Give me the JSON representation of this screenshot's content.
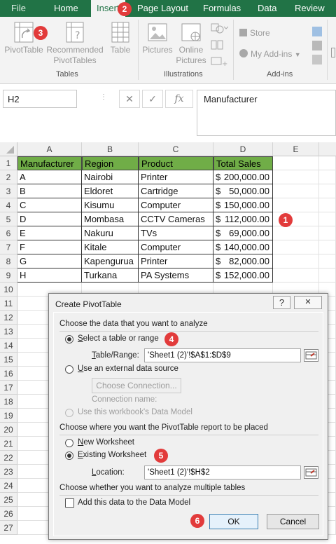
{
  "tabs": [
    "File",
    "Home",
    "Insert",
    "Page Layout",
    "Formulas",
    "Data",
    "Review"
  ],
  "badges": [
    "1",
    "2",
    "3",
    "4",
    "5",
    "6"
  ],
  "ribbon": {
    "tables": {
      "pivot": "PivotTable",
      "recommended_line1": "Recommended",
      "recommended_line2": "PivotTables",
      "table": "Table",
      "group": "Tables"
    },
    "illustrations": {
      "pictures": "Pictures",
      "online_line1": "Online",
      "online_line2": "Pictures",
      "group": "Illustrations"
    },
    "addins": {
      "store": "Store",
      "my_addins": "My Add-ins",
      "group": "Add-ins"
    }
  },
  "formula_bar": {
    "name_box": "H2",
    "fx": "fx",
    "value": "Manufacturer"
  },
  "columns": [
    "A",
    "B",
    "C",
    "D",
    "E"
  ],
  "rows": [
    "1",
    "2",
    "3",
    "4",
    "5",
    "6",
    "7",
    "8",
    "9",
    "10",
    "11",
    "12",
    "13",
    "14",
    "15",
    "16",
    "17",
    "18",
    "19",
    "20",
    "21",
    "22",
    "23",
    "24",
    "25",
    "26",
    "27"
  ],
  "sheet": {
    "headers": [
      "Manufacturer",
      "Region",
      "Product",
      "Total Sales"
    ],
    "data": [
      [
        "A",
        "Nairobi",
        "Printer",
        "200,000.00"
      ],
      [
        "B",
        "Eldoret",
        "Cartridge",
        "50,000.00"
      ],
      [
        "C",
        "Kisumu",
        "Computer",
        "150,000.00"
      ],
      [
        "D",
        "Mombasa",
        "CCTV Cameras",
        "112,000.00"
      ],
      [
        "E",
        "Nakuru",
        "TVs",
        "69,000.00"
      ],
      [
        "F",
        "Kitale",
        "Computer",
        "140,000.00"
      ],
      [
        "G",
        "Kapengurua",
        "Printer",
        "82,000.00"
      ],
      [
        "H",
        "Turkana",
        "PA Systems",
        "152,000.00"
      ]
    ],
    "currency": "$"
  },
  "dialog": {
    "title": "Create PivotTable",
    "help": "?",
    "close": "✕",
    "section1": "Choose the data that you want to analyze",
    "select_table": "Select a table or range",
    "table_range_label": "Table/Range:",
    "table_range_value": "'Sheet1 (2)'!$A$1:$D$9",
    "external": "Use an external data source",
    "choose_connection": "Choose Connection...",
    "connection_name": "Connection name:",
    "data_model": "Use this workbook's Data Model",
    "section2": "Choose where you want the PivotTable report to be placed",
    "new_worksheet": "New Worksheet",
    "existing_worksheet": "Existing Worksheet",
    "location_label": "Location:",
    "location_value": "'Sheet1 (2)'!$H$2",
    "section3": "Choose whether you want to analyze multiple tables",
    "add_data_model": "Add this data to the Data Model",
    "ok": "OK",
    "cancel": "Cancel"
  },
  "colors": {
    "excel_green": "#217346",
    "header_fill": "#70ad47",
    "badge": "#e23b3b"
  }
}
